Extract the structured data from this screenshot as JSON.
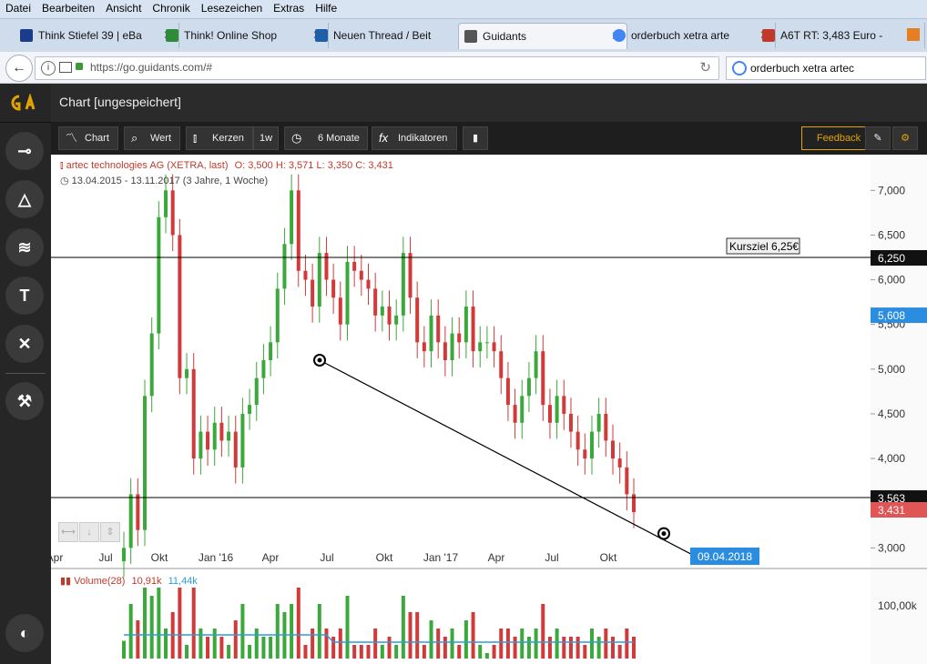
{
  "menu": [
    "Datei",
    "Bearbeiten",
    "Ansicht",
    "Chronik",
    "Lesezeichen",
    "Extras",
    "Hilfe"
  ],
  "tabs": [
    {
      "label": "Think Stiefel 39 | eBa",
      "color": "#1a3c8a"
    },
    {
      "label": "Think! Online Shop",
      "color": "#2e8b3a"
    },
    {
      "label": "Neuen Thread / Beit",
      "color": "#1f5fa8"
    },
    {
      "label": "Guidants",
      "color": "#555555",
      "active": true
    },
    {
      "label": "orderbuch xetra arte",
      "color": "#4285f4"
    },
    {
      "label": "A6T RT: 3,483 Euro -",
      "color": "#c0392b"
    }
  ],
  "nav": {
    "url": "https://go.guidants.com/#",
    "search": "orderbuch xetra artec"
  },
  "app": {
    "title": "Chart [ungespeichert]",
    "logo": "GA",
    "accent": "#e2a400"
  },
  "toolbar": {
    "chart": "Chart",
    "wert": "Wert",
    "kerzen": "Kerzen",
    "interval": "1w",
    "range": "6 Monate",
    "indikatoren": "Indikatoren",
    "feedback": "Feedback"
  },
  "legend": {
    "name": "artec technologies AG (XETRA, last)",
    "ohlc": "O: 3,500  H: 3,571  L: 3,350  C: 3,431",
    "range": "13.04.2015 - 13.11.2017   (3 Jahre, 1 Woche)"
  },
  "chart_data": {
    "type": "candlestick",
    "ylim": [
      2.8,
      7.4
    ],
    "yticks": [
      "7,000",
      "6,500",
      "6,000",
      "5,500",
      "5,000",
      "4,500",
      "4,000",
      "3,000"
    ],
    "xticks": [
      "Apr",
      "Jul",
      "Okt",
      "Jan '16",
      "Apr",
      "Jul",
      "Okt",
      "Jan '17",
      "Apr",
      "Jul",
      "Okt"
    ],
    "hlines": [
      6.25,
      3.563
    ],
    "annotation": "Kursziel 6,25€",
    "price_labels": {
      "hline_top": "6,250",
      "hline_bottom": "3,563",
      "marker": "5,608",
      "last": "3,431"
    },
    "trendline_end_date": "09.04.2018",
    "closes": [
      3.0,
      3.6,
      3.2,
      4.7,
      5.4,
      6.7,
      7.0,
      6.5,
      4.9,
      5.0,
      4.0,
      4.3,
      4.1,
      4.4,
      4.2,
      4.3,
      3.9,
      4.5,
      4.6,
      4.9,
      5.1,
      5.3,
      5.9,
      6.4,
      7.0,
      6.1,
      6.0,
      5.7,
      6.3,
      6.0,
      5.8,
      5.5,
      6.2,
      6.1,
      6.0,
      5.9,
      5.6,
      5.7,
      5.5,
      5.6,
      6.3,
      5.8,
      5.3,
      5.2,
      5.6,
      5.3,
      5.1,
      5.4,
      5.3,
      5.7,
      5.2,
      5.3,
      5.3,
      5.2,
      4.9,
      4.6,
      4.4,
      4.7,
      4.9,
      5.2,
      4.6,
      4.4,
      4.7,
      4.5,
      4.3,
      4.1,
      4.0,
      4.3,
      4.5,
      4.2,
      4.0,
      3.9,
      3.6,
      3.4
    ],
    "volume_label": "Volume(28)",
    "volume_values": [
      "10,91k",
      "11,44k"
    ],
    "volume_axis": "100,00k"
  }
}
